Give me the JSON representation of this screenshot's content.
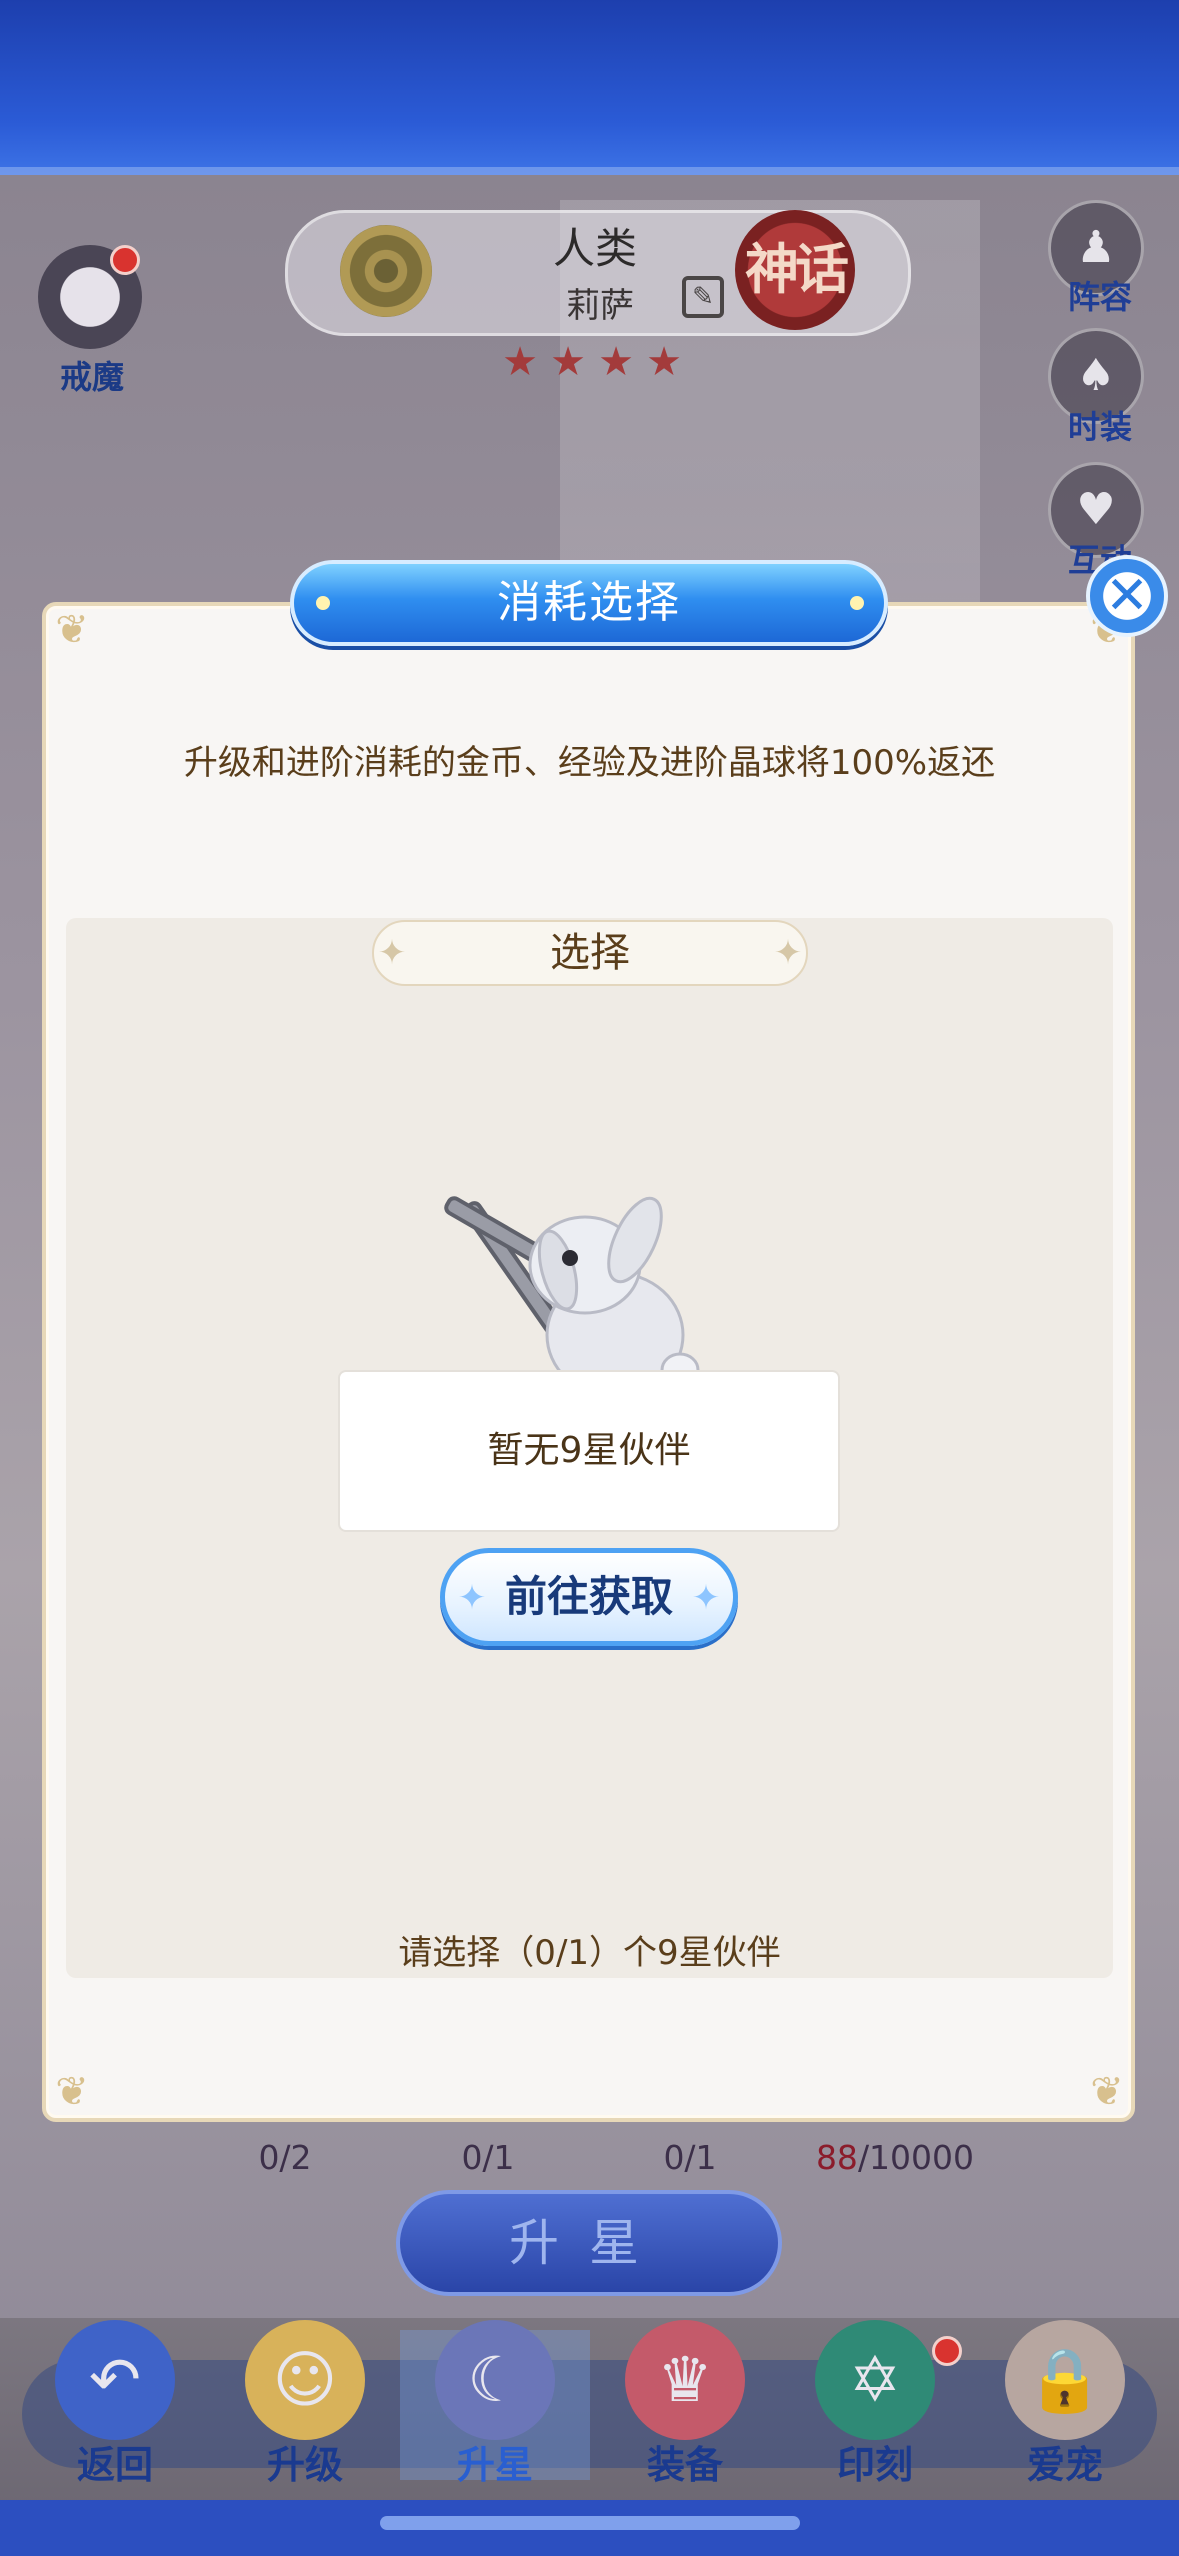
{
  "header": {
    "race": "人类",
    "hero_name": "莉萨",
    "rank_label": "神话",
    "stars": [
      "★",
      "★",
      "★",
      "★"
    ],
    "left_badge": "戒魔"
  },
  "side_menu": [
    {
      "label": "阵容",
      "icon": "♟"
    },
    {
      "label": "时装",
      "icon": "♠"
    },
    {
      "label": "互动",
      "icon": "♥"
    }
  ],
  "modal": {
    "title": "消耗选择",
    "description": "升级和进阶消耗的金币、经验及进阶晶球将100%返还",
    "section_title": "选择",
    "empty_text": "暂无9星伙伴",
    "goto_button": "前往获取",
    "hint": "请选择（0/1）个9星伙伴",
    "close_icon": "✕"
  },
  "costs": [
    {
      "value": "0/2"
    },
    {
      "value": "0/1"
    },
    {
      "value": "0/1"
    },
    {
      "current": "88",
      "total": "/10000"
    }
  ],
  "upgrade_button": "升星",
  "nav": [
    {
      "label": "返回",
      "icon": "↶"
    },
    {
      "label": "升级",
      "icon": "☺"
    },
    {
      "label": "升星",
      "icon": "☾"
    },
    {
      "label": "装备",
      "icon": "♛"
    },
    {
      "label": "印刻",
      "icon": "✡"
    },
    {
      "label": "爱宠",
      "icon": "🔒"
    }
  ]
}
